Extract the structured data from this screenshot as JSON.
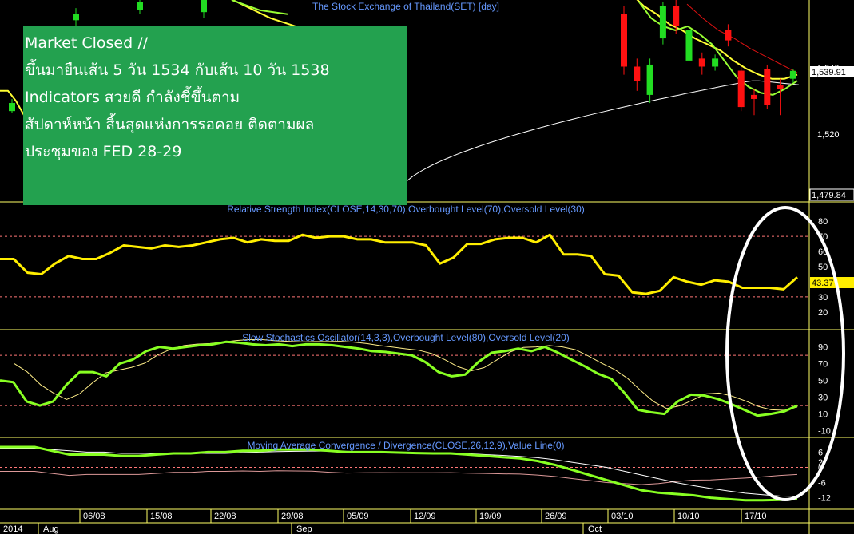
{
  "note": {
    "lines": [
      "Market Closed //",
      "ขึ้นมายืนเส้น 5 วัน 1534 กับเส้น 10 วัน 1538",
      "Indicators สวยดี กำลังชี้ขึ้นตาม",
      "สัปดาห์หน้า สิ้นสุดแห่งการรอคอย ติดตามผล",
      "ประชุมของ FED 28-29"
    ]
  },
  "colors": {
    "background": "#000000",
    "panel_border": "#ffff66",
    "candle_up": "#22dd22",
    "candle_down": "#ff1111",
    "ma_short": "#ffff33",
    "ma_mid": "#99ff33",
    "ma_long": "#ffffff",
    "ma_red": "#dd1111",
    "rsi_line": "#ffee00",
    "stoch_k": "#88ff22",
    "stoch_d": "#ffee88",
    "macd_line": "#88ff22",
    "macd_signal": "#ffffff",
    "reference_line": "#ff7777",
    "annotation_ellipse": "#ffffff",
    "title_text": "#6699ff",
    "note_box": "#23a14f"
  },
  "chart_data": [
    {
      "type": "candlestick",
      "title": "The Stock Exchange of Thailand(SET) [day]",
      "y_ticks": [
        "1,540",
        "1,520"
      ],
      "last_value": "1,539.91",
      "low_value": "1,479.84",
      "ylim": [
        1475,
        1575
      ],
      "candles_late": [
        {
          "o": 1568,
          "c": 1542,
          "h": 1572,
          "l": 1538
        },
        {
          "o": 1542,
          "c": 1535,
          "h": 1546,
          "l": 1530
        },
        {
          "o": 1528,
          "c": 1543,
          "h": 1546,
          "l": 1524
        },
        {
          "o": 1556,
          "c": 1572,
          "h": 1574,
          "l": 1553
        },
        {
          "o": 1572,
          "c": 1562,
          "h": 1575,
          "l": 1558
        },
        {
          "o": 1545,
          "c": 1560,
          "h": 1562,
          "l": 1542
        },
        {
          "o": 1546,
          "c": 1542,
          "h": 1549,
          "l": 1538
        },
        {
          "o": 1542,
          "c": 1546,
          "h": 1548,
          "l": 1540
        },
        {
          "o": 1560,
          "c": 1555,
          "h": 1563,
          "l": 1552
        },
        {
          "o": 1540,
          "c": 1522,
          "h": 1542,
          "l": 1520
        },
        {
          "o": 1528,
          "c": 1526,
          "h": 1531,
          "l": 1518
        },
        {
          "o": 1541,
          "c": 1523,
          "h": 1543,
          "l": 1521
        },
        {
          "o": 1533,
          "c": 1531,
          "h": 1536,
          "l": 1518
        },
        {
          "o": 1536,
          "c": 1539.91,
          "h": 1541,
          "l": 1534
        }
      ],
      "candles_early": [
        {
          "o": 1520,
          "c": 1524,
          "h": 1526,
          "l": 1519
        },
        {
          "o": 1565,
          "c": 1568,
          "h": 1571,
          "l": 1562
        },
        {
          "o": 1570,
          "c": 1574,
          "h": 1575,
          "l": 1568
        },
        {
          "o": 1569,
          "c": 1575,
          "h": 1575,
          "l": 1566
        }
      ]
    },
    {
      "type": "line",
      "title": "Relative Strength Index(CLOSE,14,30,70),Overbought Level(70),Oversold Level(30)",
      "y_ticks": [
        80,
        70,
        60,
        50,
        40,
        30,
        20
      ],
      "ylim": [
        12,
        88
      ],
      "levels": [
        70,
        30
      ],
      "last_value": "43.37",
      "values": [
        55,
        55,
        46,
        45,
        52,
        57,
        55,
        55,
        59,
        64,
        63,
        62,
        64,
        63,
        64,
        66,
        68,
        69,
        66,
        68,
        67,
        67,
        71,
        69,
        70,
        70,
        68,
        68,
        66,
        66,
        66,
        64,
        52,
        56,
        65,
        65,
        68,
        69,
        69,
        66,
        71,
        58,
        58,
        57,
        45,
        44,
        33,
        32,
        34,
        43,
        40,
        38,
        41,
        40,
        36,
        36,
        36,
        35,
        43
      ]
    },
    {
      "type": "line",
      "title": "Slow Stochastics Oscillator(14,3,3),Overbought Level(80),Oversold Level(20)",
      "y_ticks": [
        90,
        70,
        50,
        30,
        10,
        -10
      ],
      "ylim": [
        -18,
        102
      ],
      "levels": [
        80,
        20
      ],
      "k_values": [
        50,
        48,
        25,
        20,
        25,
        45,
        60,
        60,
        55,
        70,
        75,
        85,
        90,
        88,
        90,
        92,
        93,
        96,
        95,
        93,
        92,
        93,
        91,
        93,
        93,
        92,
        90,
        88,
        85,
        84,
        82,
        80,
        72,
        60,
        55,
        57,
        72,
        83,
        85,
        88,
        85,
        90,
        83,
        75,
        67,
        58,
        52,
        35,
        15,
        12,
        10,
        25,
        33,
        32,
        28,
        22,
        15,
        8,
        10,
        13,
        20
      ]
    },
    {
      "type": "line",
      "title": "Moving Average Convergence / Divergence(CLOSE,26,12,9),Value Line(0)",
      "y_ticks": [
        6,
        2,
        0,
        -6,
        -12
      ],
      "ylim": [
        -14,
        8
      ],
      "levels": [
        0
      ],
      "macd_values": [
        8,
        8,
        8,
        6.5,
        5,
        5,
        5,
        4.5,
        4.5,
        5,
        5.5,
        5.5,
        6,
        6,
        6.5,
        6.5,
        7,
        7,
        7,
        6.5,
        6,
        6,
        6,
        5.8,
        5.6,
        5.5,
        5.5,
        5,
        4.5,
        4,
        3.5,
        2.5,
        1,
        -1,
        -3,
        -5,
        -7,
        -9,
        -10,
        -10.5,
        -11,
        -12,
        -12.5,
        -13,
        -13,
        -12.8,
        -12.5
      ],
      "signal_values": [
        7.5,
        7.5,
        7.5,
        7,
        6.5,
        6,
        6,
        5.5,
        5.5,
        5.5,
        5.5,
        5.5,
        5.5,
        5.5,
        5.8,
        6,
        6.2,
        6.3,
        6.4,
        6.4,
        6.3,
        6.2,
        6.1,
        6,
        5.8,
        5.7,
        5.6,
        5.4,
        5,
        4.7,
        4.3,
        3.8,
        3,
        2,
        1,
        0,
        -1.5,
        -3,
        -4.5,
        -6,
        -7.2,
        -8.3,
        -9.3,
        -10.2,
        -10.8,
        -11.3,
        -11.5
      ]
    }
  ],
  "x_axis": {
    "labels": [
      "06/08",
      "15/08",
      "22/08",
      "29/08",
      "05/09",
      "12/09",
      "19/09",
      "26/09",
      "03/10",
      "10/10",
      "17/10"
    ],
    "periods": [
      "2014",
      "Aug",
      "Sep",
      "Oct"
    ]
  }
}
